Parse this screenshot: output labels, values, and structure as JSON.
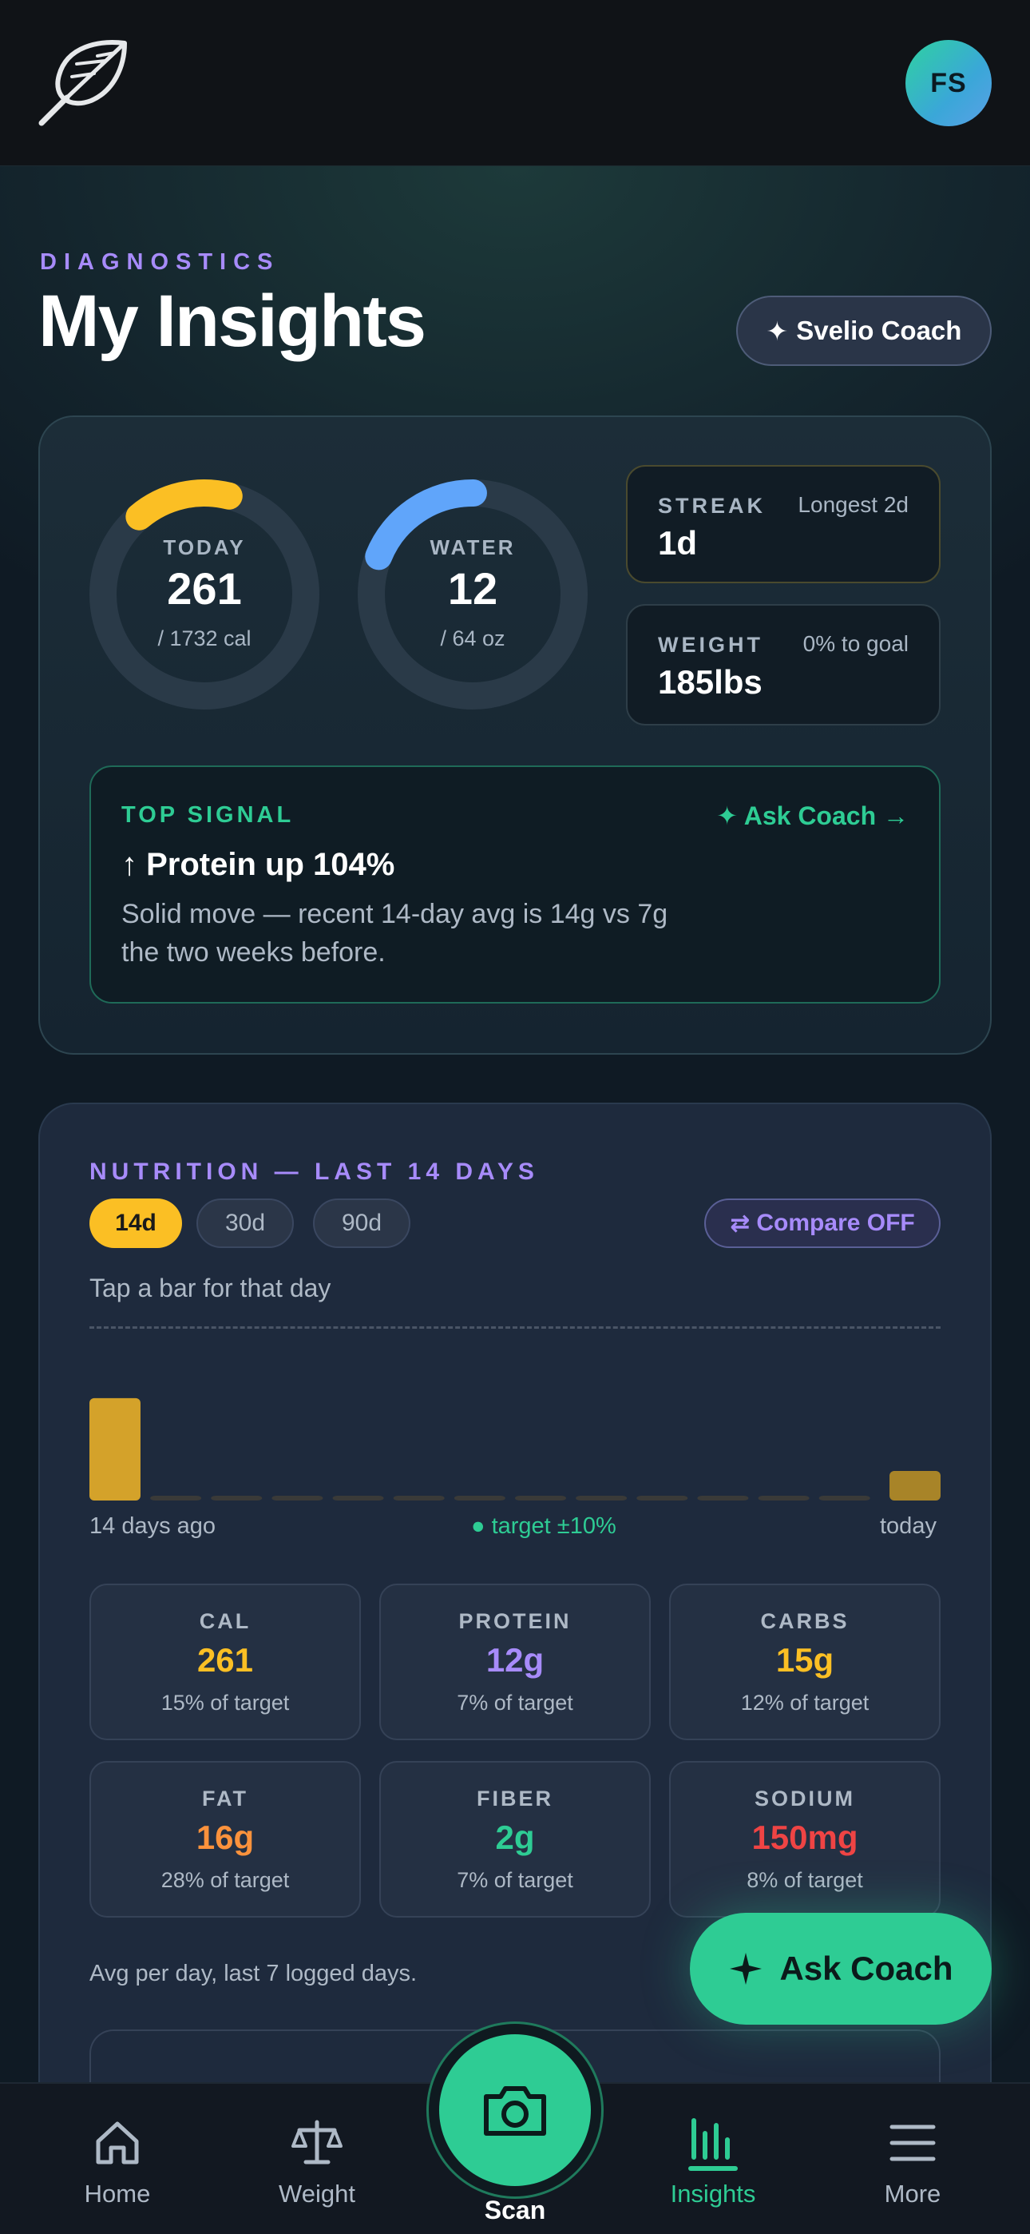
{
  "header": {
    "avatar_initials": "FS"
  },
  "page": {
    "eyebrow": "DIAGNOSTICS",
    "title": "My Insights",
    "coach_button": "Svelio Coach"
  },
  "summary": {
    "today": {
      "label": "TODAY",
      "value": "261",
      "sub": "/ 1732 cal",
      "color": "#fbbf24",
      "progress": 0.15
    },
    "water": {
      "label": "WATER",
      "value": "12",
      "sub": "/ 64 oz",
      "color": "#60a5fa",
      "progress": 0.19
    },
    "streak": {
      "label": "STREAK",
      "aside": "Longest 2d",
      "value": "1d",
      "border": "#4a4a2e"
    },
    "weight": {
      "label": "WEIGHT",
      "aside": "0% to goal",
      "value": "185lbs"
    },
    "signal": {
      "tag": "TOP SIGNAL",
      "ask": "✦ Ask Coach →",
      "headline": "↑ Protein up 104%",
      "body": "Solid move — recent 14-day avg is 14g vs 7g the two weeks before."
    }
  },
  "nutrition": {
    "label": "NUTRITION — LAST 14 DAYS",
    "ranges": [
      "14d",
      "30d",
      "90d"
    ],
    "active_range": "14d",
    "compare": "Compare OFF",
    "hint": "Tap a bar for that day",
    "axis_left": "14 days ago",
    "axis_center": "● target ±10%",
    "axis_right": "today",
    "chart_data": {
      "type": "bar",
      "x": [
        "d1",
        "d2",
        "d3",
        "d4",
        "d5",
        "d6",
        "d7",
        "d8",
        "d9",
        "d10",
        "d11",
        "d12",
        "d13",
        "d14"
      ],
      "values": [
        0.52,
        0.02,
        0.02,
        0.02,
        0.02,
        0.02,
        0.02,
        0.02,
        0.02,
        0.02,
        0.02,
        0.02,
        0.02,
        0.15
      ],
      "ylim": [
        0,
        1.3
      ],
      "bar_color": "#d4a22a",
      "today_color": "#a88428",
      "empty_color": "#3a3a38"
    },
    "macros": [
      {
        "label": "CAL",
        "value": "261",
        "sub": "15% of target",
        "color": "#fbbf24"
      },
      {
        "label": "PROTEIN",
        "value": "12g",
        "sub": "7% of target",
        "color": "#a78bfa"
      },
      {
        "label": "CARBS",
        "value": "15g",
        "sub": "12% of target",
        "color": "#fbbf24"
      },
      {
        "label": "FAT",
        "value": "16g",
        "sub": "28% of target",
        "color": "#fb923c"
      },
      {
        "label": "FIBER",
        "value": "2g",
        "sub": "7% of target",
        "color": "#2ecc94"
      },
      {
        "label": "SODIUM",
        "value": "150mg",
        "sub": "8% of target",
        "color": "#ef4444"
      }
    ],
    "avg_note": "Avg per day, last 7 logged days."
  },
  "fab": {
    "label": "Ask Coach"
  },
  "nav": {
    "home": "Home",
    "weight": "Weight",
    "scan": "Scan",
    "insights": "Insights",
    "more": "More"
  }
}
